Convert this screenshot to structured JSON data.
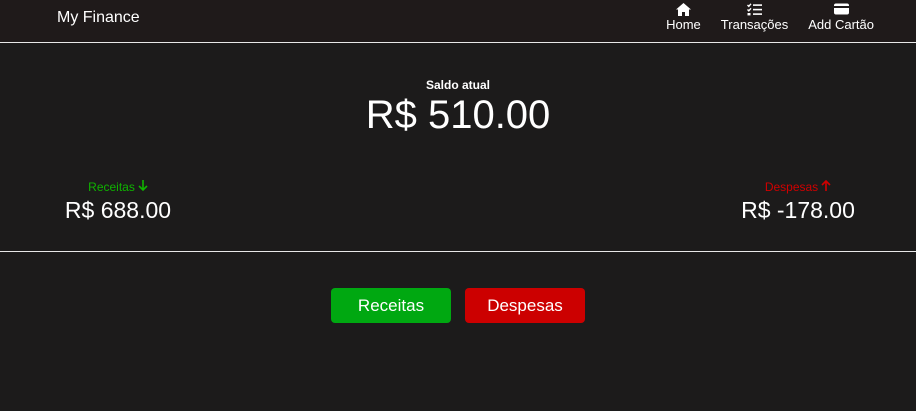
{
  "header": {
    "brand": "My Finance",
    "nav": [
      {
        "label": "Home",
        "icon": "home-icon"
      },
      {
        "label": "Transações",
        "icon": "checklist-icon"
      },
      {
        "label": "Add Cartão",
        "icon": "card-icon"
      }
    ]
  },
  "summary": {
    "balance_label": "Saldo atual",
    "balance_value": "R$ 510.00",
    "income_label": "Receitas",
    "income_value": "R$ 688.00",
    "expense_label": "Despesas",
    "expense_value": "R$ -178.00"
  },
  "actions": {
    "income_button": "Receitas",
    "expense_button": "Despesas"
  },
  "colors": {
    "background": "#1c1b1b",
    "income": "#00a811",
    "expense": "#cc0000"
  }
}
